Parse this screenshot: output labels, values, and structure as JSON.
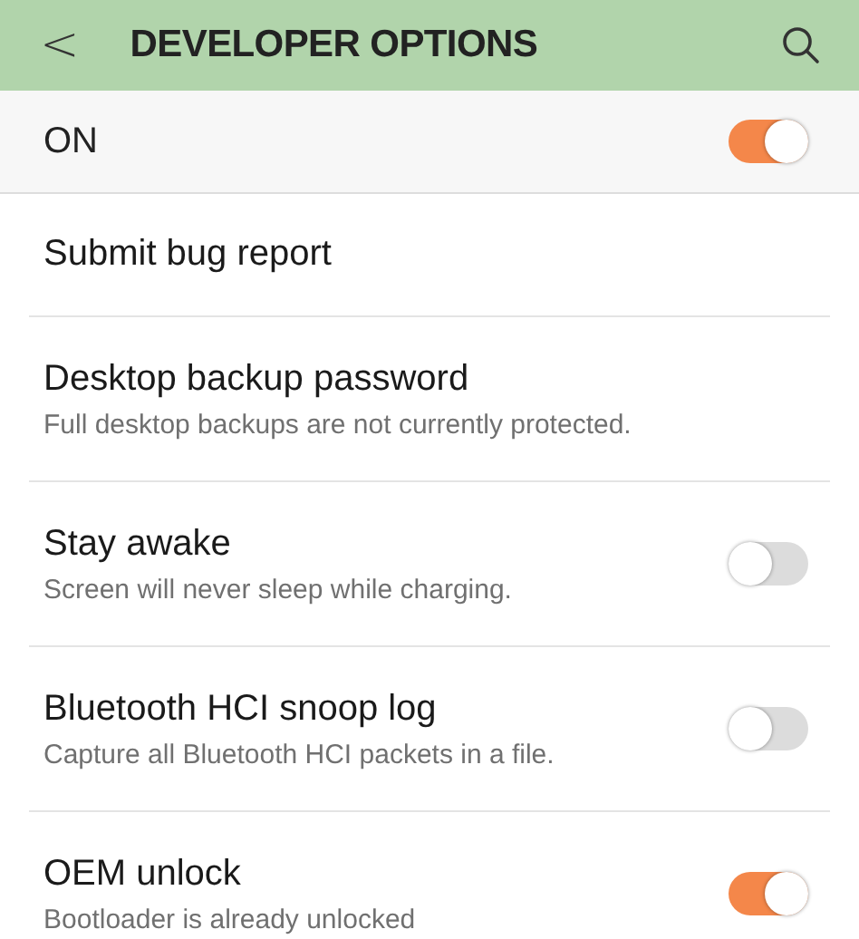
{
  "header": {
    "back": "<",
    "title": "DEVELOPER OPTIONS"
  },
  "master": {
    "label": "ON",
    "on": true
  },
  "items": [
    {
      "kind": "plain",
      "title": "Submit bug report"
    },
    {
      "kind": "plain",
      "title": "Desktop backup password",
      "subtitle": "Full desktop backups are not currently protected."
    },
    {
      "kind": "switch",
      "title": "Stay awake",
      "subtitle": "Screen will never sleep while charging.",
      "on": false
    },
    {
      "kind": "switch",
      "title": "Bluetooth HCI snoop log",
      "subtitle": "Capture all Bluetooth HCI packets in a file.",
      "on": false
    },
    {
      "kind": "switch",
      "title": "OEM unlock",
      "subtitle": "Bootloader is already unlocked",
      "on": true
    }
  ]
}
